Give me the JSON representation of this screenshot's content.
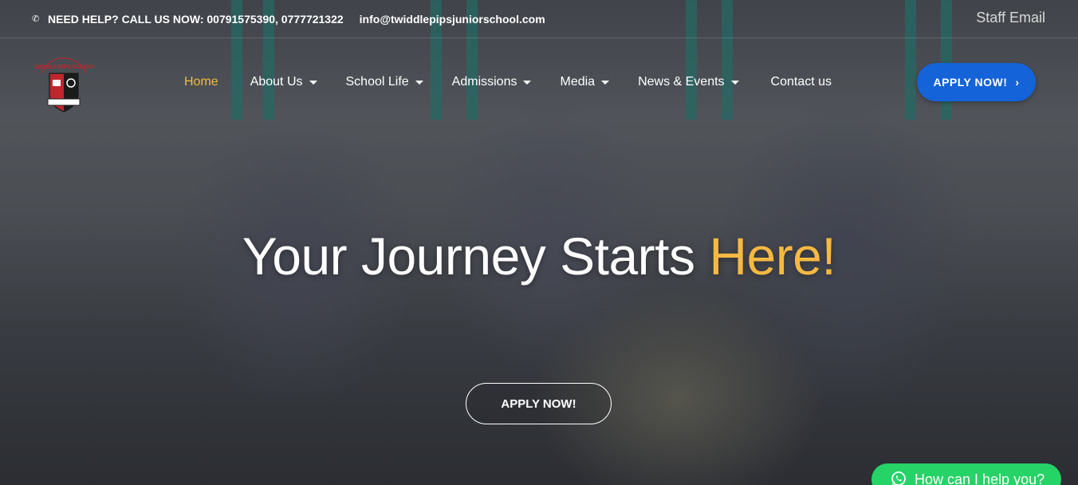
{
  "topbar": {
    "phone_icon": "phone-icon",
    "help_text": "NEED HELP? CALL US NOW: 00791575390, 0777721322",
    "email": "info@twiddlepipsjuniorschool.com",
    "staff_email": "Staff Email"
  },
  "logo": {
    "text": "TWIDDLE PIPS SCHOOL"
  },
  "nav": {
    "items": [
      {
        "label": "Home",
        "active": true,
        "dropdown": false
      },
      {
        "label": "About Us",
        "active": false,
        "dropdown": true
      },
      {
        "label": "School Life",
        "active": false,
        "dropdown": true
      },
      {
        "label": "Admissions",
        "active": false,
        "dropdown": true
      },
      {
        "label": "Media",
        "active": false,
        "dropdown": true
      },
      {
        "label": "News & Events",
        "active": false,
        "dropdown": true
      },
      {
        "label": "Contact us",
        "active": false,
        "dropdown": false
      }
    ],
    "apply_label": "APPLY NOW!"
  },
  "hero": {
    "title_main": "Your Journey Starts ",
    "title_highlight": "Here!",
    "apply_label": "APPLY NOW!"
  },
  "whatsapp": {
    "label": "How can I help you?",
    "icon": "whatsapp-icon"
  },
  "colors": {
    "accent": "#f5b841",
    "button_blue": "#1463d8",
    "whatsapp_green": "#25d366"
  }
}
